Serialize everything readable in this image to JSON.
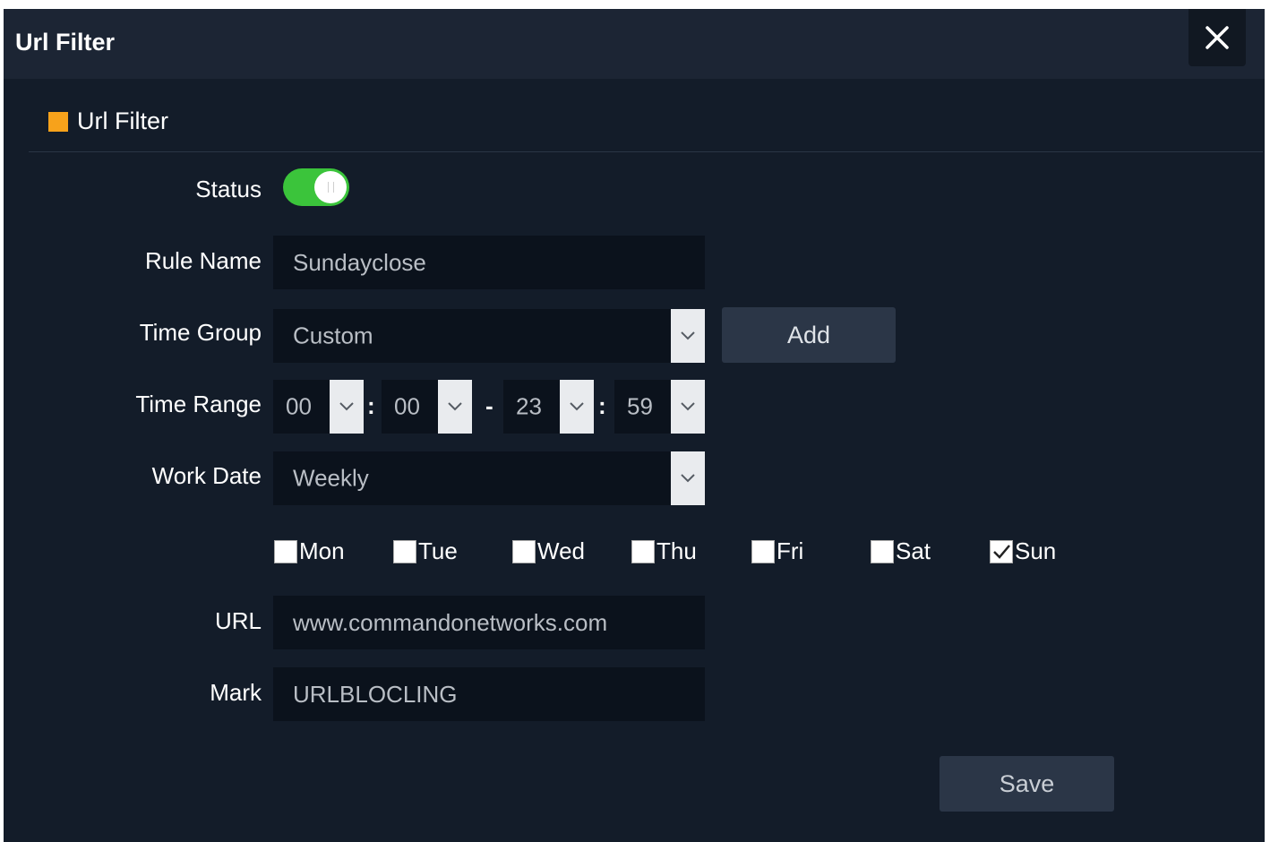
{
  "dialog": {
    "title": "Url Filter"
  },
  "section": {
    "title": "Url Filter",
    "marker_color": "#f7a21b"
  },
  "form": {
    "status": {
      "label": "Status",
      "enabled": true,
      "on_color": "#3bc43b"
    },
    "rule_name": {
      "label": "Rule Name",
      "value": "Sundayclose"
    },
    "time_group": {
      "label": "Time Group",
      "value": "Custom",
      "add_label": "Add"
    },
    "time_range": {
      "label": "Time Range",
      "start_hour": "00",
      "start_minute": "00",
      "end_hour": "23",
      "end_minute": "59",
      "colon": ":",
      "dash": "-"
    },
    "work_date": {
      "label": "Work Date",
      "value": "Weekly",
      "days": [
        {
          "label": "Mon",
          "checked": false
        },
        {
          "label": "Tue",
          "checked": false
        },
        {
          "label": "Wed",
          "checked": false
        },
        {
          "label": "Thu",
          "checked": false
        },
        {
          "label": "Fri",
          "checked": false
        },
        {
          "label": "Sat",
          "checked": false
        },
        {
          "label": "Sun",
          "checked": true
        }
      ]
    },
    "url": {
      "label": "URL",
      "value": "www.commandonetworks.com"
    },
    "mark": {
      "label": "Mark",
      "value": "URLBLOCLING"
    }
  },
  "actions": {
    "save_label": "Save"
  },
  "icons": {
    "close": "close-icon",
    "dropdown": "chevron-down-icon",
    "check": "checkmark-icon"
  }
}
